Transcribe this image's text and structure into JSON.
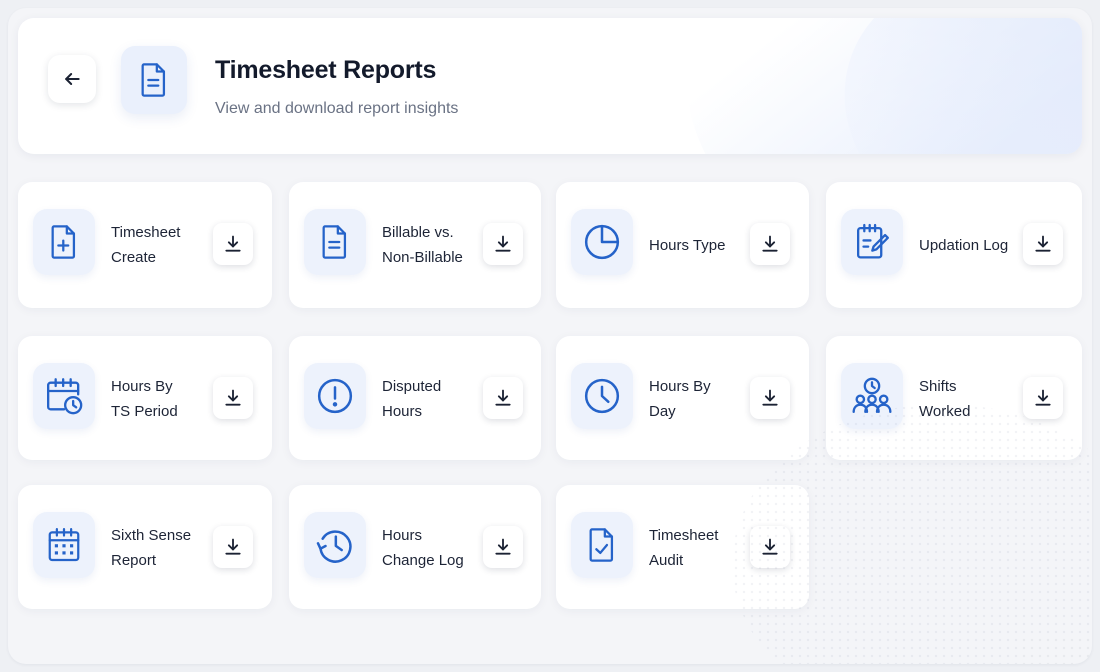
{
  "header": {
    "title": "Timesheet Reports",
    "subtitle": "View and download report insights",
    "back_icon": "arrow-left-icon",
    "hero_icon": "document-icon"
  },
  "colors": {
    "accent": "#2563c9",
    "tile_bg": "#edf2fc",
    "page_bg": "#f4f5f8"
  },
  "reports": [
    {
      "line1": "Timesheet",
      "line2": "Create",
      "icon": "file-plus-icon"
    },
    {
      "line1": "Billable vs.",
      "line2": "Non-Billable",
      "icon": "document-lines-icon"
    },
    {
      "line1": "Hours Type",
      "line2": "",
      "icon": "pie-chart-icon"
    },
    {
      "line1": "Updation Log",
      "line2": "",
      "icon": "clipboard-edit-icon"
    },
    {
      "line1": "Hours By",
      "line2": "TS Period",
      "icon": "calendar-clock-icon"
    },
    {
      "line1": "Disputed",
      "line2": "Hours",
      "icon": "alert-circle-icon"
    },
    {
      "line1": "Hours By",
      "line2": "Day",
      "icon": "clock-icon"
    },
    {
      "line1": "Shifts",
      "line2": "Worked",
      "icon": "team-clock-icon"
    },
    {
      "line1": "Sixth Sense",
      "line2": "Report",
      "icon": "calendar-grid-icon"
    },
    {
      "line1": "Hours",
      "line2": "Change Log",
      "icon": "history-icon"
    },
    {
      "line1": "Timesheet",
      "line2": "Audit",
      "icon": "file-check-icon"
    }
  ],
  "download_icon": "download-icon"
}
